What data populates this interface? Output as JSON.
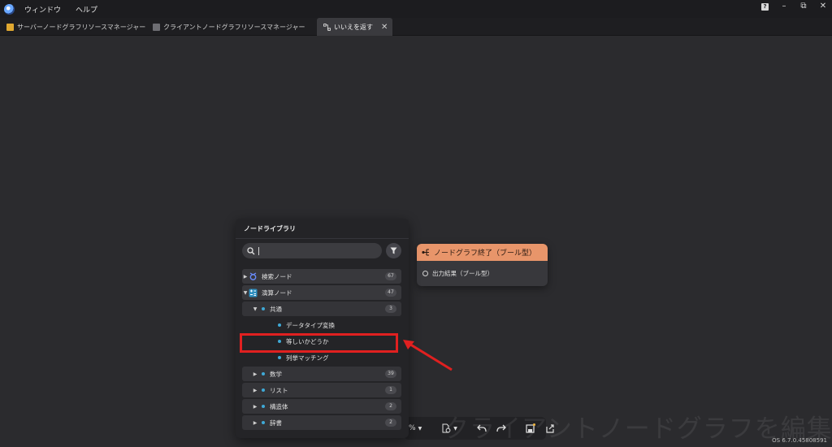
{
  "menubar": {
    "items": [
      "ウィンドウ",
      "ヘルプ"
    ]
  },
  "window_controls": {
    "help": "?",
    "minimize": "–",
    "restore": "⧉",
    "close": "✕"
  },
  "tabs": [
    {
      "label": "サーバーノードグラフリソースマネージャー",
      "icon": "server-graph-icon",
      "active": false
    },
    {
      "label": "クライアントノードグラフリソースマネージャー",
      "icon": "client-graph-icon",
      "active": false
    },
    {
      "label": "いいえを返す",
      "icon": "node-graph-icon",
      "active": true
    }
  ],
  "node_library": {
    "title": "ノードライブラリ",
    "search": {
      "value": "",
      "placeholder": ""
    },
    "tree": [
      {
        "label": "検索ノード",
        "count": "67"
      },
      {
        "label": "演算ノード",
        "count": "47"
      },
      {
        "label": "共通",
        "count": "3"
      },
      {
        "label": "データタイプ変換"
      },
      {
        "label": "等しいかどうか"
      },
      {
        "label": "列挙マッチング"
      },
      {
        "label": "数学",
        "count": "39"
      },
      {
        "label": "リスト",
        "count": "1"
      },
      {
        "label": "構造体",
        "count": "2"
      },
      {
        "label": "辞書",
        "count": "2"
      }
    ]
  },
  "graph_node": {
    "title": "ノードグラフ終了（ブール型）",
    "port_label": "出力結果（ブール型）",
    "header_color": "#e8956a"
  },
  "toolbar": {
    "zoom_suffix": "%"
  },
  "watermark": "クライアントノードグラフを編集",
  "version": "OS 6.7.0.45808591",
  "annotation_color": "#e02020"
}
